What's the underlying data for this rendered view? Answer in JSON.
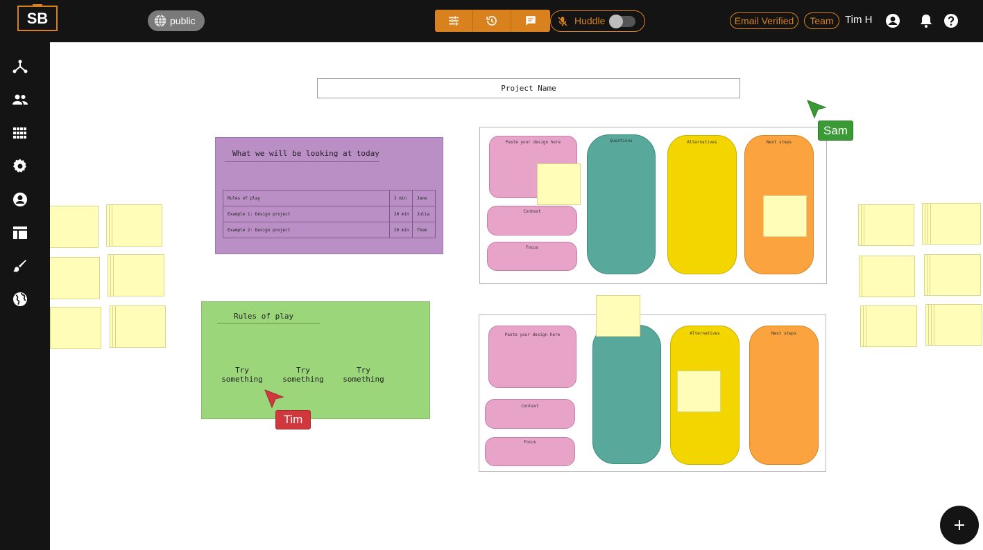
{
  "app": {
    "logo_text": "SB"
  },
  "header": {
    "visibility_label": "public",
    "tools": [
      {
        "icon": "sliders-icon"
      },
      {
        "icon": "history-icon"
      },
      {
        "icon": "chat-icon"
      }
    ],
    "huddle_label": "Huddle",
    "huddle_enabled": false,
    "email_badge": "Email Verified",
    "team_badge": "Team",
    "user_name": "Tim H"
  },
  "sidebar": {
    "items": [
      {
        "icon": "network-icon"
      },
      {
        "icon": "people-icon"
      },
      {
        "icon": "grid-icon"
      },
      {
        "icon": "gear-icon"
      },
      {
        "icon": "account-icon"
      },
      {
        "icon": "table-icon"
      },
      {
        "icon": "brush-icon"
      },
      {
        "icon": "globe-icon"
      }
    ]
  },
  "canvas": {
    "project_name": "Project Name",
    "agenda": {
      "title": "What we will be looking at today",
      "rows": [
        {
          "item": "Rules of play",
          "time": "2 min",
          "owner": "Jane"
        },
        {
          "item": "Example 1: Design project",
          "time": "20 min",
          "owner": "Julia"
        },
        {
          "item": "Example 2: Design project",
          "time": "20 min",
          "owner": "Thom"
        }
      ]
    },
    "rules": {
      "title": "Rules of play",
      "items": [
        "Try something",
        "Try something",
        "Try something"
      ]
    },
    "board_top": {
      "paste": "Paste your design here",
      "context": "Context",
      "focus": "Focus",
      "questions": "Questions",
      "alternatives": "Alternatives",
      "next_steps": "Next steps"
    },
    "board_bottom": {
      "paste": "Paste your design here",
      "context": "Context",
      "focus": "Focus",
      "alternatives": "Alternatives",
      "next_steps": "Next steps"
    },
    "cursors": [
      {
        "name": "Sam",
        "color": "#3a9a35"
      },
      {
        "name": "Tim",
        "color": "#d0383e"
      }
    ]
  },
  "colors": {
    "accent": "#d9821d",
    "sticky": "#fffdb8"
  }
}
